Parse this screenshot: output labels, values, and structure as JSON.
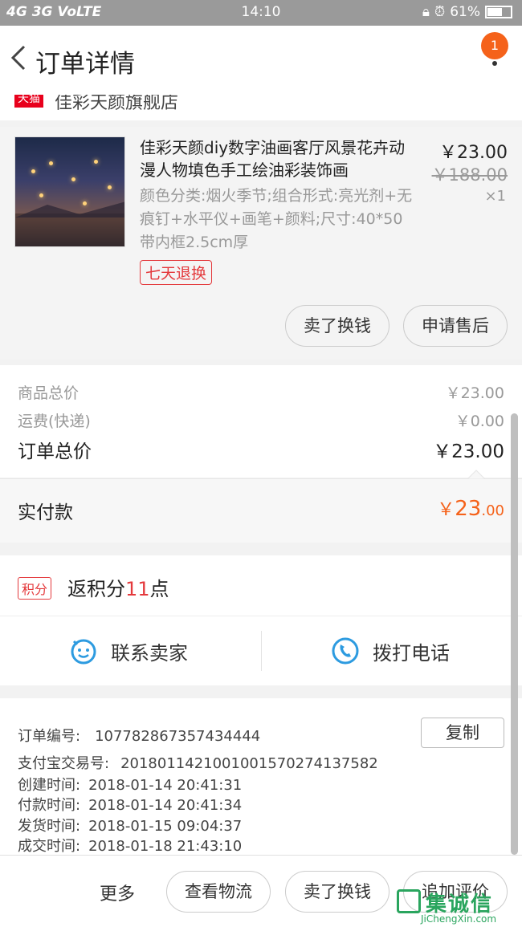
{
  "status": {
    "network": "4G 3G VoLTE",
    "time": "14:10",
    "battery": "61%"
  },
  "nav": {
    "title": "订单详情",
    "badge": "1"
  },
  "shop": {
    "tmall_label": "天猫",
    "name": "佳彩天颜旗舰店"
  },
  "product": {
    "title": "佳彩天颜diy数字油画客厅风景花卉动漫人物填色手工绘油彩装饰画",
    "spec": "颜色分类:烟火季节;组合形式:亮光剂+无痕钉+水平仪+画笔+颜料;尺寸:40*50带内框2.5cm厚",
    "price": "￥23.00",
    "original_price": "￥188.00",
    "quantity": "×1",
    "tag": "七天退换",
    "buttons": {
      "sell": "卖了换钱",
      "aftersale": "申请售后"
    }
  },
  "totals": {
    "goods_label": "商品总价",
    "goods_value": "￥23.00",
    "shipping_label": "运费(快递)",
    "shipping_value": "￥0.00",
    "order_label": "订单总价",
    "order_value": "￥23.00",
    "paid_label": "实付款",
    "paid_symbol": "￥",
    "paid_int": "23",
    "paid_dec": ".00"
  },
  "points": {
    "tag": "积分",
    "prefix": "返积分",
    "count": "11",
    "suffix": "点"
  },
  "contact": {
    "seller": "联系卖家",
    "phone": "拨打电话"
  },
  "order_info": {
    "order_no_label": "订单编号:",
    "order_no": "107782867357434444",
    "copy": "复制",
    "alipay_label": "支付宝交易号:",
    "alipay_no": "2018011421001001570274137582",
    "created_label": "创建时间:",
    "created": "2018-01-14 20:41:31",
    "paid_label": "付款时间:",
    "paid": "2018-01-14 20:41:34",
    "shipped_label": "发货时间:",
    "shipped": "2018-01-15 09:04:37",
    "done_label": "成交时间:",
    "done": "2018-01-18 21:43:10"
  },
  "bottom": {
    "more": "更多",
    "logistics": "查看物流",
    "sell": "卖了换钱",
    "review": "追加评价"
  },
  "watermark": {
    "text": "集诚信",
    "url": "JiChengXin.com"
  },
  "colors": {
    "accent_red": "#e4393c",
    "paid_orange": "#f5621a",
    "icon_blue": "#2d9be0"
  }
}
